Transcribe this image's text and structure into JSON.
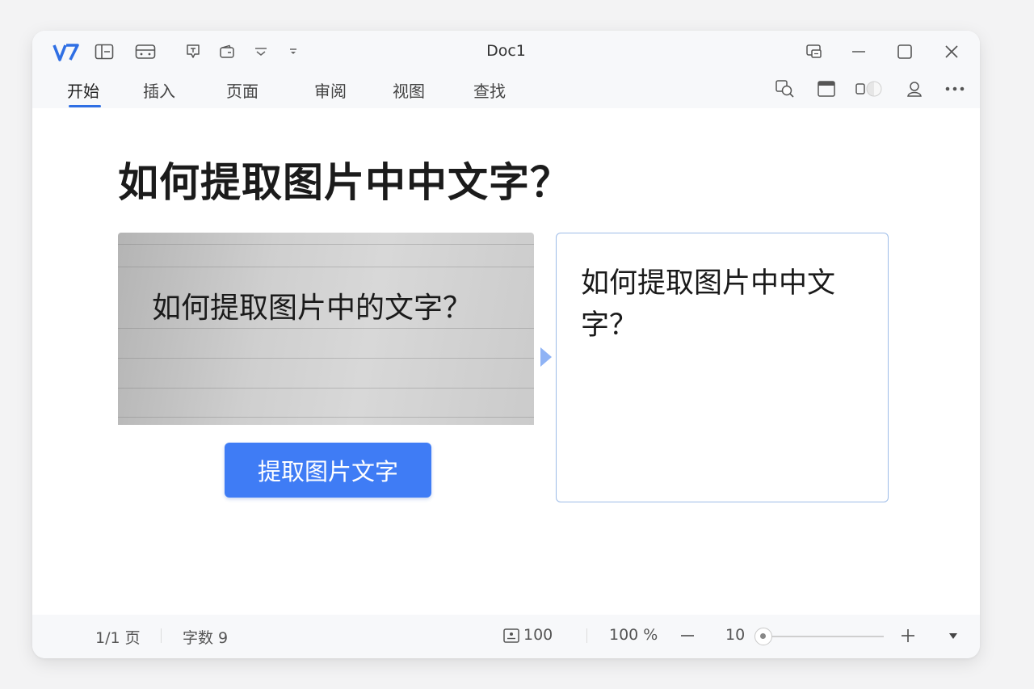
{
  "window": {
    "title": "Doc1",
    "tabs": [
      {
        "label": "开始"
      },
      {
        "label": "插入"
      },
      {
        "label": "页面"
      },
      {
        "label": "审阅"
      },
      {
        "label": "视图"
      },
      {
        "label": "查找"
      }
    ]
  },
  "document": {
    "heading": "如何提取图片中中文字？",
    "image_text": "如何提取图片中的文字？",
    "extract_button_label": "提取图片文字",
    "result_text": "如何提取图片中中文字？"
  },
  "statusbar": {
    "page": "1/1 页",
    "word_count": "字数 9",
    "view_value": "100",
    "zoom": "100 %",
    "zoom_step": "10",
    "zoom_level_fraction": 0.0
  },
  "colors": {
    "accent": "#3f7cf5",
    "logo": "#2f6fe4"
  },
  "icons": [
    "logo-icon",
    "layout-icon",
    "card-icon",
    "format-icon",
    "wallet-icon",
    "dropdown-icon",
    "more-dropdown-icon",
    "screen-icon",
    "minimize-icon",
    "maximize-icon",
    "close-icon",
    "copy-search-icon",
    "window-icon",
    "toggle-icon",
    "user-icon",
    "more-icon",
    "page-icon",
    "zoom-out-icon",
    "zoom-in-icon",
    "chevron-down-icon"
  ]
}
